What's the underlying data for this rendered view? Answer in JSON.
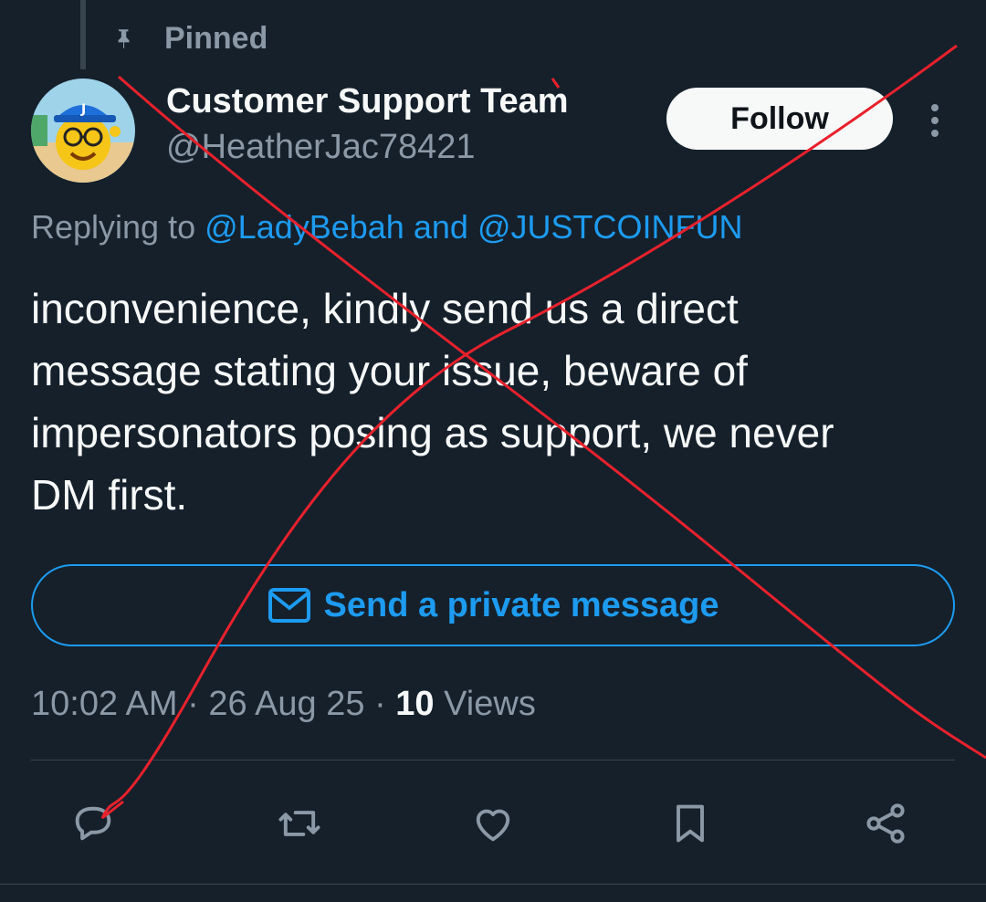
{
  "pinned": {
    "label": "Pinned",
    "icon": "pin-icon"
  },
  "author": {
    "name": "Customer Support Team",
    "handle": "@HeatherJac78421",
    "avatar_badge_letter": "J"
  },
  "follow_label": "Follow",
  "replying": {
    "prefix": "Replying to",
    "user1": "@LadyBebah",
    "conjunction": "and",
    "user2": "@JUSTCOINFUN"
  },
  "tweet_lines": [
    "inconvenience, kindly send us a direct",
    "message stating your issue, beware of",
    "impersonators posing as support, we never",
    "DM first."
  ],
  "dm_button": {
    "label": "Send a private message",
    "icon": "mail-icon"
  },
  "meta": {
    "time": "10:02 AM",
    "separator": "·",
    "date": "26 Aug 25",
    "views_count": "10",
    "views_label": "Views"
  },
  "actions": [
    "reply-icon",
    "retweet-icon",
    "like-icon",
    "bookmark-icon",
    "share-icon"
  ],
  "colors": {
    "background": "#15202b",
    "accent": "#1d9bf0",
    "secondary_text": "#8b98a5",
    "annotation": "#e8212c"
  }
}
